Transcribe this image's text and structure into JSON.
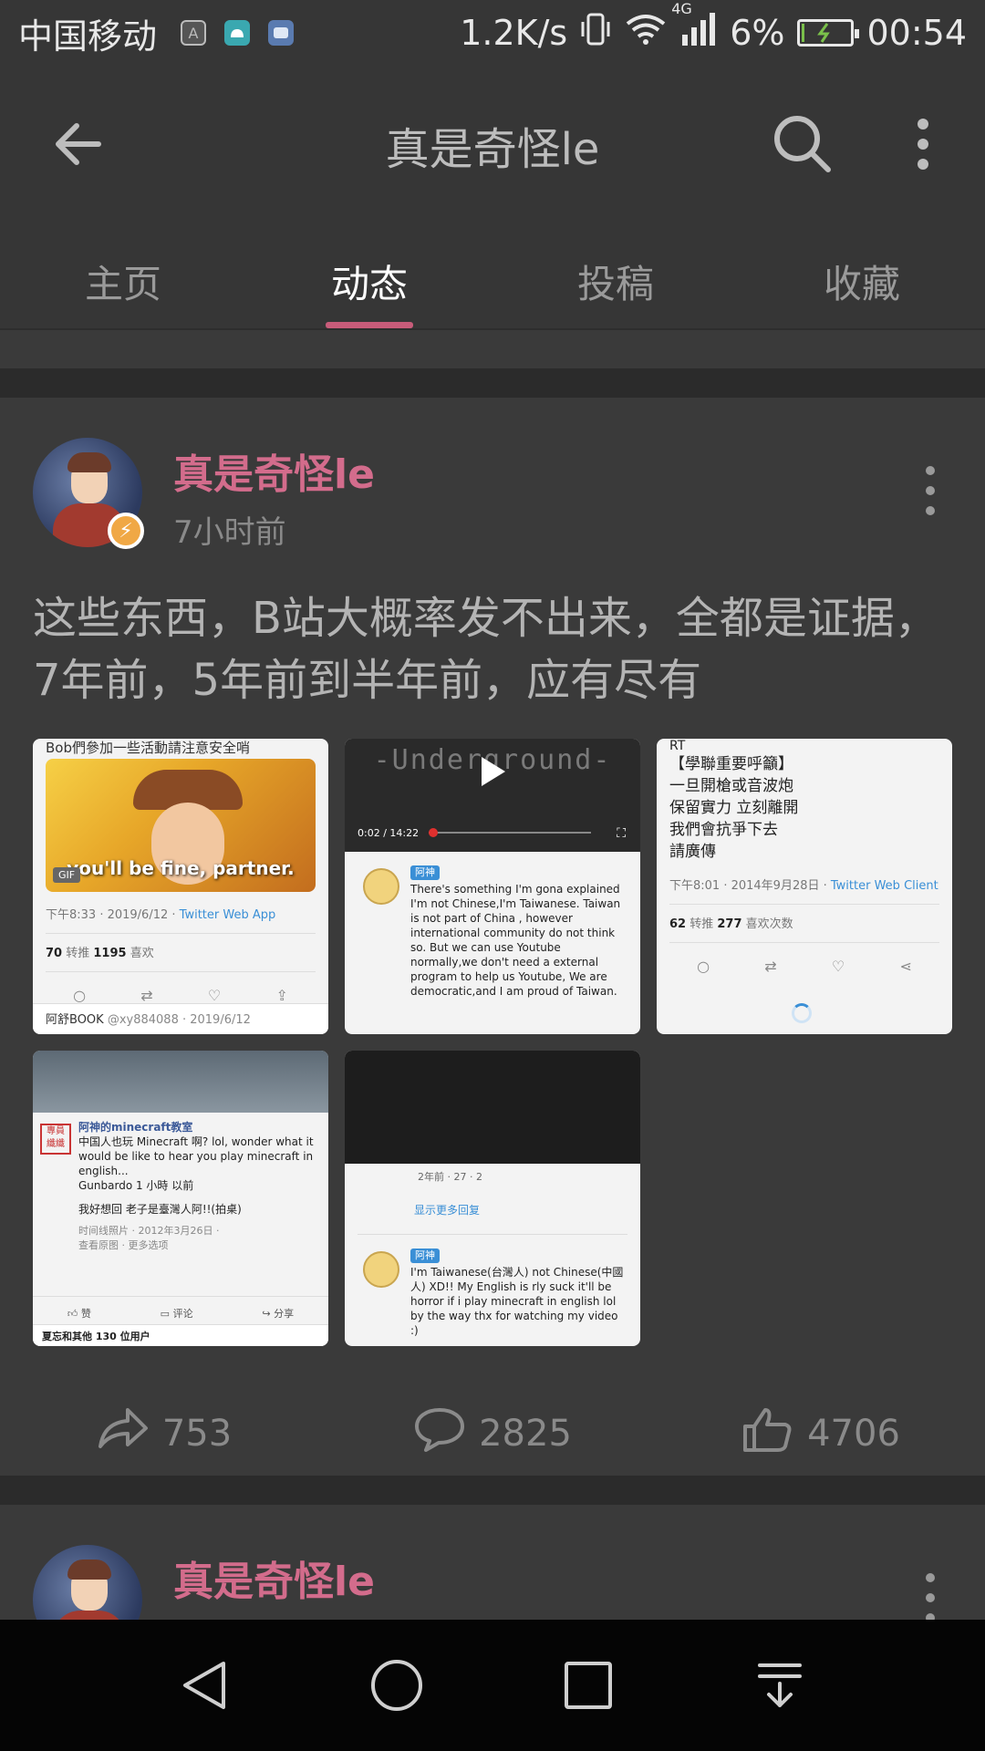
{
  "status_bar": {
    "carrier": "中国移动",
    "icons": [
      "a-notification-icon",
      "android-icon",
      "gallery-icon"
    ],
    "net_speed": "1.2K/s",
    "network": "4G",
    "battery_percent": "6%",
    "battery_level": 0.06,
    "time": "00:54"
  },
  "appbar": {
    "title": "真是奇怪le",
    "icons": [
      "back-arrow-icon",
      "search-icon",
      "more-vert-icon"
    ]
  },
  "tabs": [
    {
      "label": "主页",
      "active": false
    },
    {
      "label": "动态",
      "active": true
    },
    {
      "label": "投稿",
      "active": false
    },
    {
      "label": "收藏",
      "active": false
    }
  ],
  "colors": {
    "accent": "#c85c7a",
    "username": "#d36c8c",
    "background": "#3a3a3a",
    "statusbar": "#363636"
  },
  "post": {
    "username": "真是奇怪le",
    "time": "7小时前",
    "text": "这些东西，B站大概率发不出来，全都是证据，7年前，5年前到半年前，应有尽有",
    "images": {
      "img1": {
        "top_text": "Bob們參加一些活動請注意安全哨",
        "caption": "you'll be fine, partner.",
        "gif_label": "GIF",
        "meta_time": "下午8:33 · 2019/6/12 · ",
        "meta_client": "Twitter Web App",
        "retweets": "70",
        "retweets_label": "转推",
        "likes": "1195",
        "likes_label": "喜欢",
        "reply_name": "阿舒BOOK",
        "reply_handle": "@xy884088 · 2019/6/12"
      },
      "img2": {
        "video_title": "-Underground-",
        "video_time": "0:02 / 14:22",
        "tag": "阿神",
        "comment": "There's something I'm gona explained I'm not Chinese,I'm Taiwanese. Taiwan is not part of China , however international community do not think so. But we can use Youtube normally,we don't need a external program to help us Youtube, We are democratic,and I am proud of Taiwan."
      },
      "img3": {
        "rt": "RT",
        "lines": [
          "【學聯重要呼籲】",
          "一旦開槍或音波炮",
          "保留實力 立刻離開",
          "我們會抗爭下去",
          "請廣傳"
        ],
        "meta_time": "下午8:01 · 2014年9月28日 · ",
        "meta_client": "Twitter Web Client",
        "retweets": "62",
        "retweets_label": "转推",
        "likes": "277",
        "likes_label": "喜欢次数"
      },
      "img4": {
        "stamp": "專員纖纖",
        "name": "阿神的minecraft教室",
        "text": "中国人也玩 Minecraft 啊? lol, wonder what it would be like to hear you play minecraft in english...",
        "sub": "Gunbardo 1 小時 以前",
        "reply": "我好想回 老子是臺灣人阿!!(拍桌)",
        "meta1": "时间线照片 · 2012年3月26日 ·",
        "meta2": "查看原图 · 更多选项",
        "like": "赞",
        "comment": "评论",
        "share": "分享",
        "likes_line": "夏忘和其他 130 位用户"
      },
      "img5": {
        "meta": "2年前 ·  27  ·  2",
        "more_replies": "显示更多回复",
        "tag": "阿神",
        "comment": "I'm Taiwanese(台灣人) not Chinese(中國人) XD!! My English is rly suck it'll be horror if i play minecraft in english lol by the way thx for watching my video :)"
      }
    },
    "shares": "753",
    "comments": "2825",
    "likes": "4706"
  },
  "post2": {
    "username": "真是奇怪le"
  },
  "navbar": {
    "icons": [
      "nav-back-icon",
      "nav-home-icon",
      "nav-recents-icon",
      "nav-notification-pull-icon"
    ]
  }
}
